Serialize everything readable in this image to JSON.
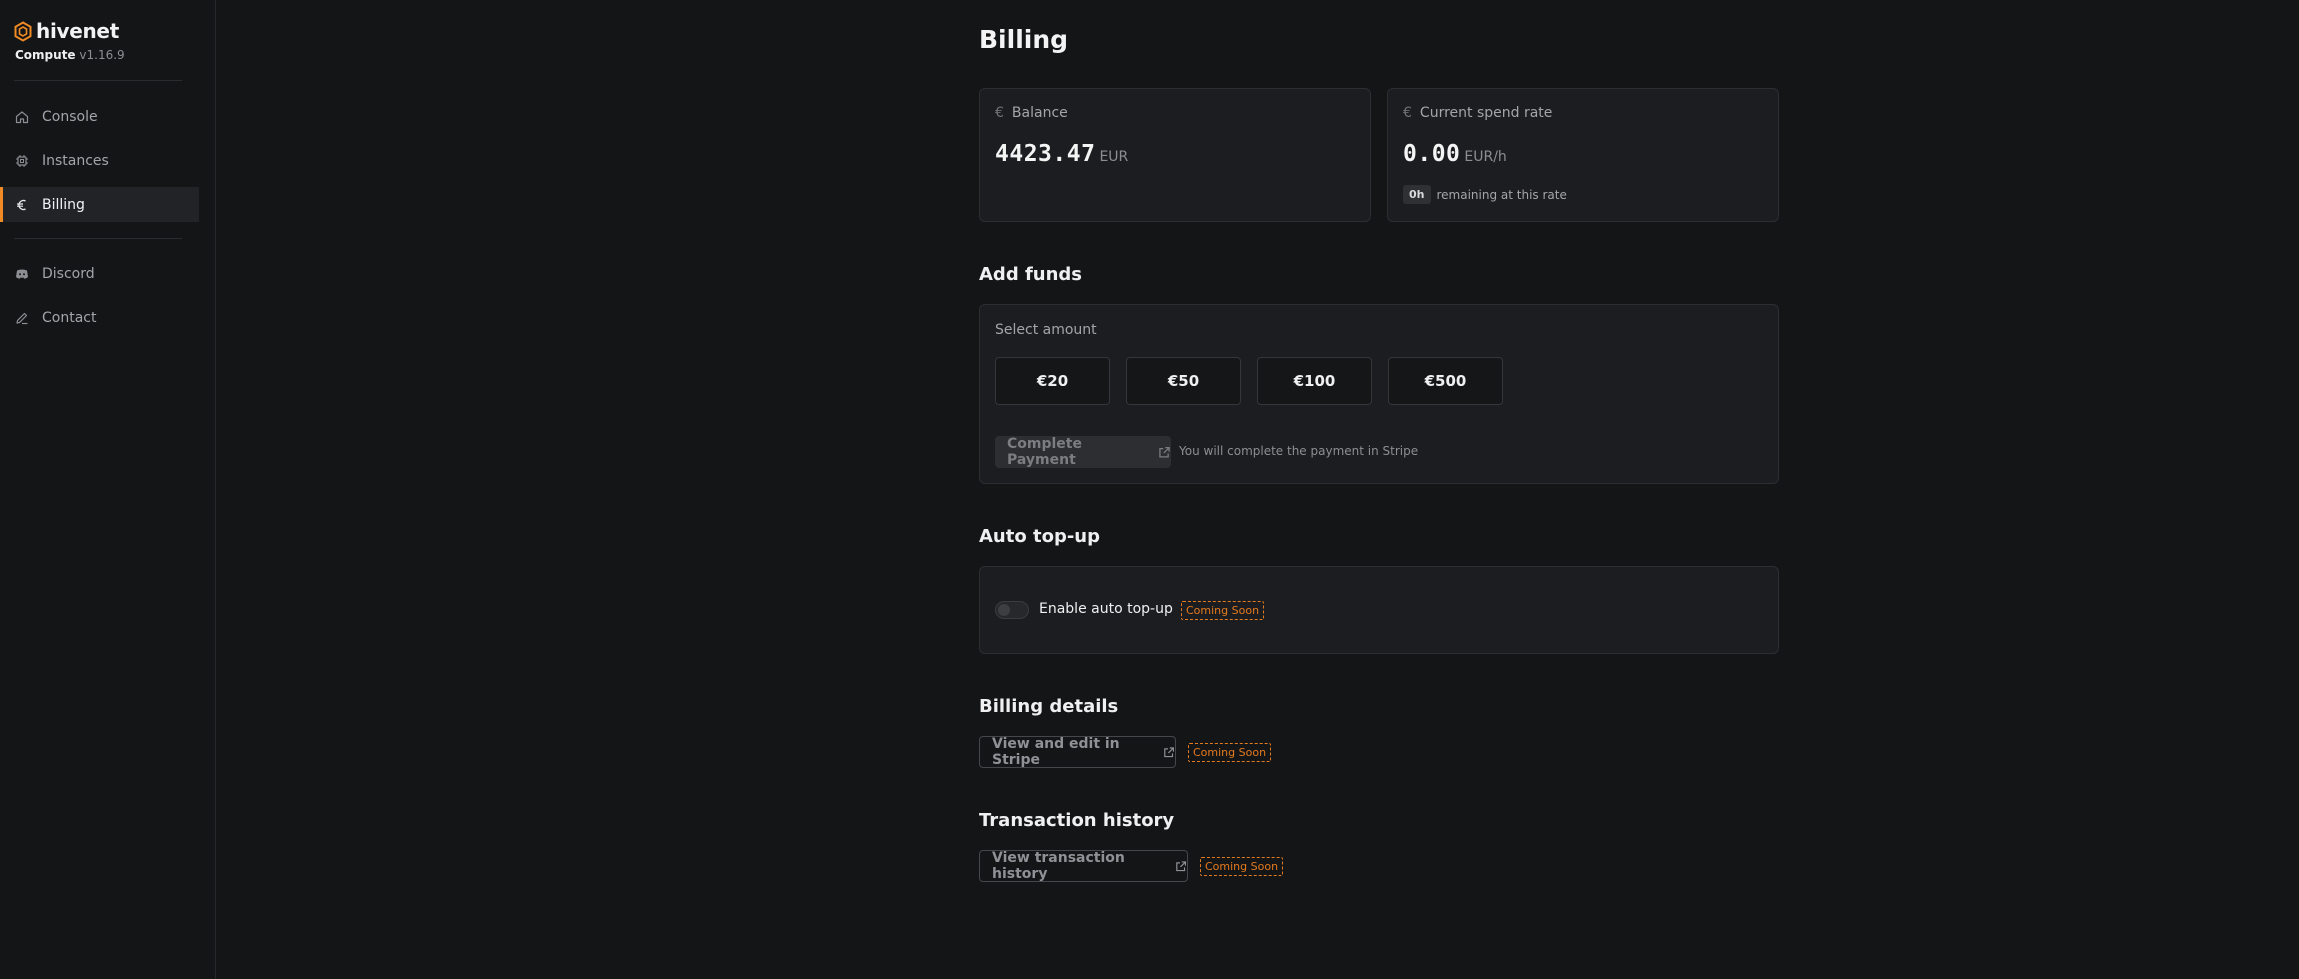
{
  "brand": {
    "name": "hivenet",
    "product": "Compute",
    "version": "v1.16.9"
  },
  "sidebar": {
    "items": [
      {
        "label": "Console",
        "icon": "home-icon"
      },
      {
        "label": "Instances",
        "icon": "cpu-icon"
      },
      {
        "label": "Billing",
        "icon": "euro-icon",
        "active": true
      },
      {
        "label": "Discord",
        "icon": "discord-icon"
      },
      {
        "label": "Contact",
        "icon": "pencil-icon"
      }
    ]
  },
  "page": {
    "title": "Billing"
  },
  "balance": {
    "label": "Balance",
    "currency_symbol": "€",
    "value": "4423.47",
    "unit": "EUR"
  },
  "spend": {
    "label": "Current spend rate",
    "currency_symbol": "€",
    "value": "0.00",
    "unit": "EUR/h",
    "remaining_chip": "0h",
    "remaining_text": "remaining at this rate"
  },
  "add_funds": {
    "title": "Add funds",
    "select_label": "Select amount",
    "amounts": [
      "€20",
      "€50",
      "€100",
      "€500"
    ],
    "pay_button": "Complete Payment",
    "pay_note": "You will complete the payment in Stripe"
  },
  "auto_topup": {
    "title": "Auto top-up",
    "toggle_label": "Enable auto top-up",
    "enabled": false,
    "badge": "Coming Soon"
  },
  "billing_details": {
    "title": "Billing details",
    "button": "View and edit in Stripe",
    "badge": "Coming Soon"
  },
  "transactions": {
    "title": "Transaction history",
    "button": "View transaction history",
    "badge": "Coming Soon"
  },
  "colors": {
    "accent": "#f08a24",
    "background": "#141517",
    "card": "#1c1d20"
  }
}
